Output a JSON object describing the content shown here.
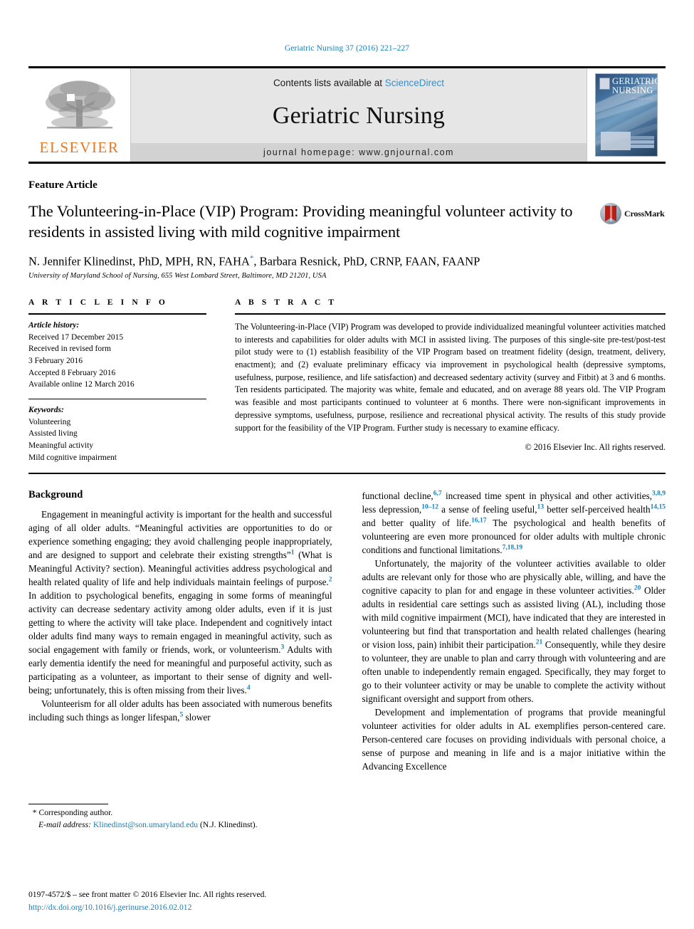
{
  "running_head": "Geriatric Nursing 37 (2016) 221–227",
  "masthead": {
    "contents_prefix": "Contents lists available at ",
    "sciencedirect": "ScienceDirect",
    "journal_title": "Geriatric Nursing",
    "homepage": "journal homepage: www.gnjournal.com",
    "publisher_logo_text": "ELSEVIER",
    "cover": {
      "title_line1": "GERIATRIC",
      "title_line2": "NURSING",
      "subtitle": "PREMIER AGING"
    }
  },
  "article": {
    "kicker": "Feature Article",
    "title": "The Volunteering-in-Place (VIP) Program: Providing meaningful volunteer activity to residents in assisted living with mild cognitive impairment",
    "crossmark_label": "CrossMark",
    "authors_part1": "N. Jennifer Klinedinst, PhD, MPH, RN, FAHA",
    "authors_marker": "*",
    "authors_part2": ", Barbara Resnick, PhD, CRNP, FAAN, FAANP",
    "affiliation": "University of Maryland School of Nursing, 655 West Lombard Street, Baltimore, MD 21201, USA"
  },
  "info": {
    "heading": "A R T I C L E   I N F O",
    "history_label": "Article history:",
    "history_lines": [
      "Received 17 December 2015",
      "Received in revised form",
      "3 February 2016",
      "Accepted 8 February 2016",
      "Available online 12 March 2016"
    ],
    "keywords_label": "Keywords:",
    "keywords": [
      "Volunteering",
      "Assisted living",
      "Meaningful activity",
      "Mild cognitive impairment"
    ]
  },
  "abstract": {
    "heading": "A B S T R A C T",
    "text": "The Volunteering-in-Place (VIP) Program was developed to provide individualized meaningful volunteer activities matched to interests and capabilities for older adults with MCI in assisted living. The purposes of this single-site pre-test/post-test pilot study were to (1) establish feasibility of the VIP Program based on treatment fidelity (design, treatment, delivery, enactment); and (2) evaluate preliminary efficacy via improvement in psychological health (depressive symptoms, usefulness, purpose, resilience, and life satisfaction) and decreased sedentary activity (survey and Fitbit) at 3 and 6 months. Ten residents participated. The majority was white, female and educated, and on average 88 years old. The VIP Program was feasible and most participants continued to volunteer at 6 months. There were non-significant improvements in depressive symptoms, usefulness, purpose, resilience and recreational physical activity. The results of this study provide support for the feasibility of the VIP Program. Further study is necessary to examine efficacy.",
    "copyright": "© 2016 Elsevier Inc. All rights reserved."
  },
  "body": {
    "left_heading": "Background",
    "paragraphs": [
      {
        "column": "left",
        "segments": [
          {
            "t": "Engagement in meaningful activity is important for the health and successful aging of all older adults. “Meaningful activities are opportunities to do or experience something engaging; they avoid challenging people inappropriately, and are designed to support and celebrate their existing strengths”"
          },
          {
            "ref": "1"
          },
          {
            "t": " (What is Meaningful Activity? section). Meaningful activities address psychological and health related quality of life and help individuals maintain feelings of purpose."
          },
          {
            "ref": "2"
          },
          {
            "t": " In addition to psychological benefits, engaging in some forms of meaningful activity can decrease sedentary activity among older adults, even if it is just getting to where the activity will take place. Independent and cognitively intact older adults find many ways to remain engaged in meaningful activity, such as social engagement with family or friends, work, or volunteerism."
          },
          {
            "ref": "3"
          },
          {
            "t": " Adults with early dementia identify the need for meaningful and purposeful activity, such as participating as a volunteer, as important to their sense of dignity and well-being; unfortunately, this is often missing from their lives."
          },
          {
            "ref": "4"
          }
        ]
      },
      {
        "column": "left",
        "segments": [
          {
            "t": "Volunteerism for all older adults has been associated with numerous benefits including such things as longer lifespan,"
          },
          {
            "ref": "5"
          },
          {
            "t": " slower"
          }
        ]
      },
      {
        "column": "right",
        "no_indent": true,
        "segments": [
          {
            "t": "functional decline,"
          },
          {
            "ref": "6,7"
          },
          {
            "t": " increased time spent in physical and other activities,"
          },
          {
            "ref": "3,8,9"
          },
          {
            "t": " less depression,"
          },
          {
            "ref": "10–12"
          },
          {
            "t": " a sense of feeling useful,"
          },
          {
            "ref": "13"
          },
          {
            "t": " better self-perceived health"
          },
          {
            "ref": "14,15"
          },
          {
            "t": " and better quality of life."
          },
          {
            "ref": "16,17"
          },
          {
            "t": " The psychological and health benefits of volunteering are even more pronounced for older adults with multiple chronic conditions and functional limitations."
          },
          {
            "ref": "7,18,19"
          }
        ]
      },
      {
        "column": "right",
        "segments": [
          {
            "t": "Unfortunately, the majority of the volunteer activities available to older adults are relevant only for those who are physically able, willing, and have the cognitive capacity to plan for and engage in these volunteer activities."
          },
          {
            "ref": "20"
          },
          {
            "t": " Older adults in residential care settings such as assisted living (AL), including those with mild cognitive impairment (MCI), have indicated that they are interested in volunteering but find that transportation and health related challenges (hearing or vision loss, pain) inhibit their participation."
          },
          {
            "ref": "21"
          },
          {
            "t": " Consequently, while they desire to volunteer, they are unable to plan and carry through with volunteering and are often unable to independently remain engaged. Specifically, they may forget to go to their volunteer activity or may be unable to complete the activity without significant oversight and support from others."
          }
        ]
      },
      {
        "column": "right",
        "segments": [
          {
            "t": "Development and implementation of programs that provide meaningful volunteer activities for older adults in AL exemplifies person-centered care. Person-centered care focuses on providing individuals with personal choice, a sense of purpose and meaning in life and is a major initiative within the Advancing Excellence"
          }
        ]
      }
    ]
  },
  "footer": {
    "corresponding_marker": "*",
    "corresponding_text": "Corresponding author.",
    "email_label": "E-mail address:",
    "email": "Klinedinst@son.umaryland.edu",
    "email_suffix": "(N.J. Klinedinst).",
    "issn_line": "0197-4572/$ – see front matter © 2016 Elsevier Inc. All rights reserved.",
    "doi": "http://dx.doi.org/10.1016/j.gerinurse.2016.02.012"
  },
  "colors": {
    "link": "#1a7eb5",
    "elsevier_orange": "#e87722",
    "masthead_gray": "#e6e6e6",
    "crossmark_red": "#b32017"
  }
}
